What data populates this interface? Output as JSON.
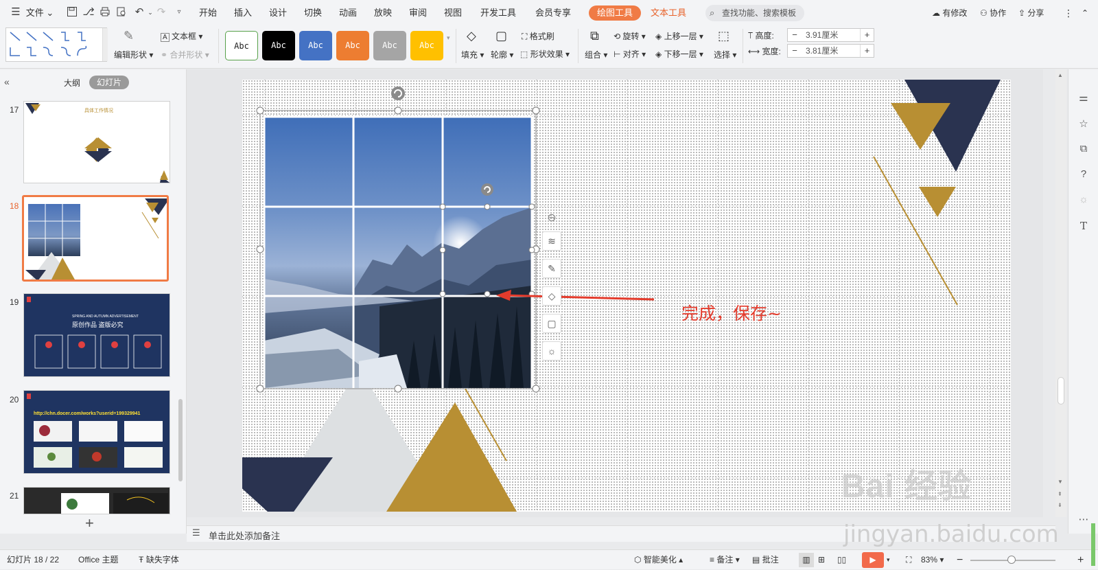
{
  "menubar": {
    "file_label": "文件",
    "tabs": [
      "开始",
      "插入",
      "设计",
      "切换",
      "动画",
      "放映",
      "审阅",
      "视图",
      "开发工具",
      "会员专享"
    ],
    "drawing_tools": "绘图工具",
    "text_tools": "文本工具",
    "search_placeholder": "查找功能、搜索模板",
    "has_changes": "有修改",
    "collaborate": "协作",
    "share": "分享"
  },
  "ribbon": {
    "edit_shape": "编辑形状",
    "text_box": "文本框",
    "merge_shape": "合并形状",
    "style_samples": [
      {
        "label": "Abc",
        "bg": "#ffffff",
        "fg": "#222222",
        "border": "#57a14a"
      },
      {
        "label": "Abc",
        "bg": "#000000",
        "fg": "#ffffff",
        "border": "#000000"
      },
      {
        "label": "Abc",
        "bg": "#4472c4",
        "fg": "#ffffff",
        "border": "#3a63ab"
      },
      {
        "label": "Abc",
        "bg": "#ed7d31",
        "fg": "#ffffff",
        "border": "#d46a22"
      },
      {
        "label": "Abc",
        "bg": "#a5a5a5",
        "fg": "#ffffff",
        "border": "#909090"
      },
      {
        "label": "Abc",
        "bg": "#ffc000",
        "fg": "#ffffff",
        "border": "#e0a800"
      }
    ],
    "fill": "填充",
    "outline": "轮廓",
    "format_painter": "格式刷",
    "shape_effects": "形状效果",
    "group": "组合",
    "rotate": "旋转",
    "align": "对齐",
    "bring_forward": "上移一层",
    "send_backward": "下移一层",
    "select": "选择",
    "height_label": "高度:",
    "height_value": "3.91厘米",
    "width_label": "宽度:",
    "width_value": "3.81厘米",
    "minus": "−",
    "plus": "+"
  },
  "left_panel": {
    "tab_outline": "大纲",
    "tab_slides": "幻灯片",
    "slide_numbers": [
      "17",
      "18",
      "19",
      "20",
      "21"
    ],
    "thumb17_title": "具体工作情况",
    "thumb19_line1": "SPRING AND AUTUMN ADVERTISEMENT",
    "thumb19_title": "原创作品  盗版必究",
    "thumb20_url": "http://chn.docer.com/works?userid=199329941",
    "add_slide": "+"
  },
  "canvas": {
    "annotation": "完成，保存~"
  },
  "notes": {
    "placeholder": "单击此处添加备注"
  },
  "status": {
    "slide_counter": "幻灯片 18 / 22",
    "theme": "Office 主题",
    "missing_fonts": "缺失字体",
    "smart_beautify": "智能美化",
    "notes": "备注",
    "comments": "批注",
    "zoom": "83%"
  },
  "watermark": {
    "brand": "Bai  经验",
    "url": "jingyan.baidu.com"
  },
  "colors": {
    "accent_orange": "#f07b45",
    "navy": "#2a3350",
    "gold": "#b88f33",
    "arrow_red": "#e43b2c"
  }
}
